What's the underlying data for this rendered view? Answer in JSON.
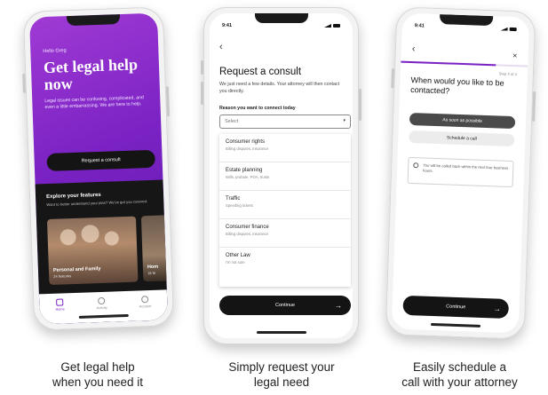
{
  "phone1": {
    "greeting": "Hello Greg",
    "headline": "Get legal help now",
    "body": "Legal issues can be confusing, complicated, and even a little embarrassing. We are here to help.",
    "cta": "Request a consult",
    "explore_title": "Explore your features",
    "explore_sub": "Want to better understand your plan? We've got you covered.",
    "cards": [
      {
        "title": "Personal and Family",
        "sub": "24 features"
      },
      {
        "title": "Hom",
        "sub": "16 fe"
      }
    ],
    "tabs": [
      "Home",
      "Activity",
      "Account"
    ],
    "accent": "#7a22c4"
  },
  "phone2": {
    "time": "9:41",
    "title": "Request a consult",
    "subtitle": "We just need a few details. Your attorney will then contact you directly.",
    "field_label": "Reason you want to connect today",
    "select_placeholder": "Select",
    "options": [
      {
        "title": "Consumer rights",
        "sub": "Billing disputes, insurance"
      },
      {
        "title": "Estate planning",
        "sub": "Wills, probate, POA, trusts"
      },
      {
        "title": "Traffic",
        "sub": "Speeding tickets"
      },
      {
        "title": "Consumer finance",
        "sub": "Billing disputes, insurance"
      },
      {
        "title": "Other Law",
        "sub": "I'm not sure"
      }
    ],
    "continue": "Continue"
  },
  "phone3": {
    "time": "9:41",
    "step": "Step 4 of 4",
    "title": "When would you like to be contacted?",
    "option_primary": "As soon as possible",
    "option_secondary": "Schedule a call",
    "note": "You will be called back within the next four business hours.",
    "continue": "Continue",
    "progress": 0.75
  },
  "captions": [
    {
      "line1": "Get legal help",
      "line2": "when you need it"
    },
    {
      "line1": "Simply request your",
      "line2": "legal need"
    },
    {
      "line1": "Easily schedule a",
      "line2": "call with your attorney"
    }
  ]
}
